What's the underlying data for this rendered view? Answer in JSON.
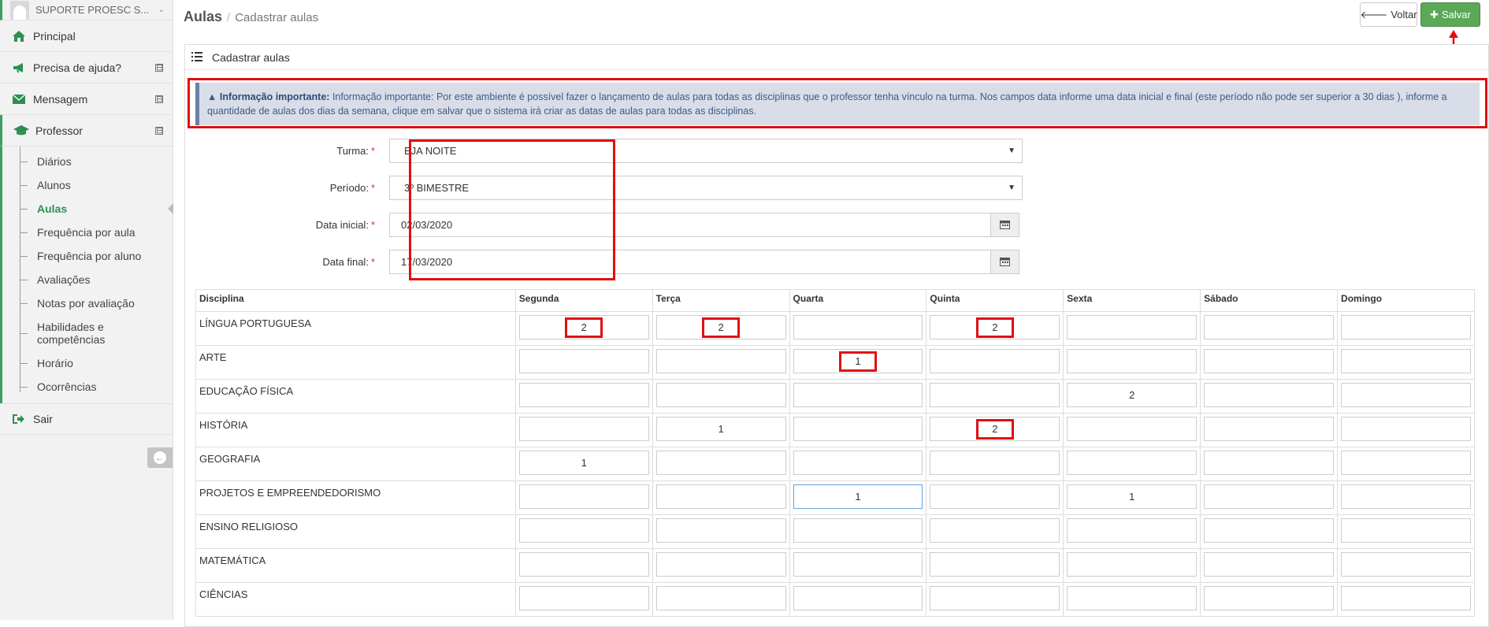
{
  "user": {
    "name": "SUPORTE PROESC S..."
  },
  "sidebar": {
    "items": [
      {
        "label": "Principal",
        "icon": "home-icon"
      },
      {
        "label": "Precisa de ajuda?",
        "icon": "megaphone-icon"
      },
      {
        "label": "Mensagem",
        "icon": "envelope-icon"
      },
      {
        "label": "Professor",
        "icon": "graduation-cap-icon"
      }
    ],
    "toggle": "⊟",
    "sub": [
      "Diários",
      "Alunos",
      "Aulas",
      "Frequência por aula",
      "Frequência por aluno",
      "Avaliações",
      "Notas por avaliação",
      "Habilidades e competências",
      "Horário",
      "Ocorrências"
    ],
    "sair": "Sair"
  },
  "header": {
    "title": "Aulas",
    "separator": "/",
    "subtitle": "Cadastrar aulas",
    "voltar": "Voltar",
    "salvar": "Salvar"
  },
  "panel": {
    "title": "Cadastrar aulas"
  },
  "info": {
    "strong": "Informação importante:",
    "text": " Informação importante: Por este ambiente é possível fazer o lançamento de aulas para todas as disciplinas que o professor tenha vínculo na turma. Nos campos data informe uma data inicial e final (este período não pode ser superior a 30 dias ), informe a quantidade de aulas dos dias da semana, clique em salvar que o sistema irá criar as datas de aulas para todas as disciplinas."
  },
  "form": {
    "turma_label": "Turma:",
    "turma_value": "EJA NOITE",
    "periodo_label": "Período:",
    "periodo_value": "3º BIMESTRE",
    "data_inicial_label": "Data inicial:",
    "data_inicial_value": "02/03/2020",
    "data_final_label": "Data final:",
    "data_final_value": "17/03/2020",
    "required": "*"
  },
  "table": {
    "headers": [
      "Disciplina",
      "Segunda",
      "Terça",
      "Quarta",
      "Quinta",
      "Sexta",
      "Sábado",
      "Domingo"
    ],
    "rows": [
      {
        "disc": "LÍNGUA PORTUGUESA",
        "vals": [
          "2",
          "2",
          "",
          "2",
          "",
          "",
          ""
        ]
      },
      {
        "disc": "ARTE",
        "vals": [
          "",
          "",
          "1",
          "",
          "",
          "",
          ""
        ]
      },
      {
        "disc": "EDUCAÇÃO FÍSICA",
        "vals": [
          "",
          "",
          "",
          "",
          "2",
          "",
          ""
        ]
      },
      {
        "disc": "HISTÓRIA",
        "vals": [
          "",
          "1",
          "",
          "2",
          "",
          "",
          ""
        ]
      },
      {
        "disc": "GEOGRAFIA",
        "vals": [
          "1",
          "",
          "",
          "",
          "",
          "",
          ""
        ]
      },
      {
        "disc": "PROJETOS E EMPREENDEDORISMO",
        "vals": [
          "",
          "",
          "1",
          "",
          "1",
          "",
          ""
        ]
      },
      {
        "disc": "ENSINO RELIGIOSO",
        "vals": [
          "",
          "",
          "",
          "",
          "",
          "",
          ""
        ]
      },
      {
        "disc": "MATEMÁTICA",
        "vals": [
          "",
          "",
          "",
          "",
          "",
          "",
          ""
        ]
      },
      {
        "disc": "CIÊNCIAS",
        "vals": [
          "",
          "",
          "",
          "",
          "",
          "",
          ""
        ]
      }
    ]
  }
}
